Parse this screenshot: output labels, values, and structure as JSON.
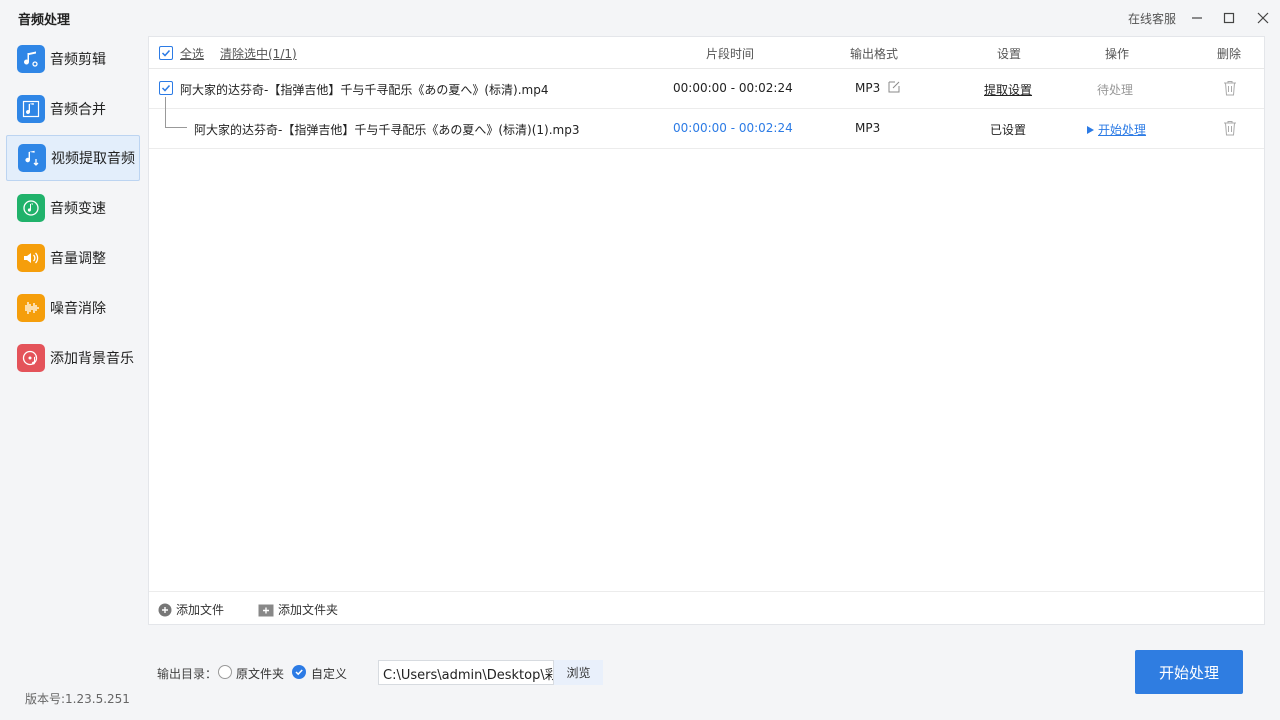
{
  "app": {
    "title": "音频处理",
    "service": "在线客服",
    "version": "版本号:1.23.5.251"
  },
  "sidebar": {
    "items": [
      {
        "label": "音频剪辑",
        "icon": "scissors-music-icon",
        "color": "#2f86e6"
      },
      {
        "label": "音频合并",
        "icon": "music-merge-icon",
        "color": "#2f86e6"
      },
      {
        "label": "视频提取音频",
        "icon": "video-extract-icon",
        "color": "#2f86e6"
      },
      {
        "label": "音频变速",
        "icon": "speed-music-icon",
        "color": "#20b26b"
      },
      {
        "label": "音量调整",
        "icon": "volume-icon",
        "color": "#f59e0b"
      },
      {
        "label": "噪音消除",
        "icon": "noise-wave-icon",
        "color": "#f59e0b"
      },
      {
        "label": "添加背景音乐",
        "icon": "bg-music-icon",
        "color": "#e4535a"
      }
    ],
    "active_index": 2
  },
  "table": {
    "select_all": "全选",
    "clear_selected": "清除选中(1/1)",
    "headers": {
      "time": "片段时间",
      "format": "输出格式",
      "settings": "设置",
      "action": "操作",
      "delete": "删除"
    },
    "rows": [
      {
        "name": "阿大家的达芬奇-【指弹吉他】千与千寻配乐《あの夏へ》(标清).mp4",
        "time": "00:00:00 - 00:02:24",
        "format": "MP3",
        "settings": "提取设置",
        "action": "待处理"
      },
      {
        "name": "阿大家的达芬奇-【指弹吉他】千与千寻配乐《あの夏へ》(标清)(1).mp3",
        "time": "00:00:00 - 00:02:24",
        "format": "MP3",
        "settings": "已设置",
        "action": "开始处理"
      }
    ]
  },
  "footer": {
    "add_file": "添加文件",
    "add_folder": "添加文件夹"
  },
  "output": {
    "label": "输出目录：",
    "option_original": "原文件夹",
    "option_custom": "自定义",
    "path": "C:\\Users\\admin\\Desktop\\彩",
    "browse": "浏览"
  },
  "start_button": "开始处理",
  "colors": {
    "accent": "#2f7de1",
    "link_blue": "#2c7be5"
  }
}
